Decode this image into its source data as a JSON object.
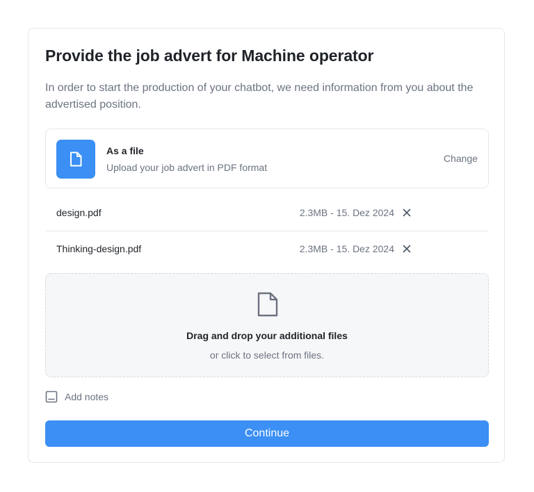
{
  "title": "Provide the job advert for Machine operator",
  "description": "In order to start the production of your chatbot, we need information from you about the advertised position.",
  "source": {
    "icon": "file-icon",
    "title": "As a file",
    "subtitle": "Upload your job advert in PDF format",
    "change_label": "Change"
  },
  "files": [
    {
      "name": "design.pdf",
      "meta": "2.3MB - 15. Dez 2024"
    },
    {
      "name": "Thinking-design.pdf",
      "meta": "2.3MB - 15. Dez 2024"
    }
  ],
  "dropzone": {
    "icon": "file-icon",
    "title": "Drag and drop your additional files",
    "subtitle": "or click to select from files."
  },
  "notes": {
    "icon": "notes-icon",
    "label": "Add notes"
  },
  "continue_label": "Continue",
  "colors": {
    "accent": "#3b8ff5",
    "muted_text": "#6b7280",
    "border": "#e5e7eb",
    "dropzone_bg": "#f6f7f9"
  }
}
